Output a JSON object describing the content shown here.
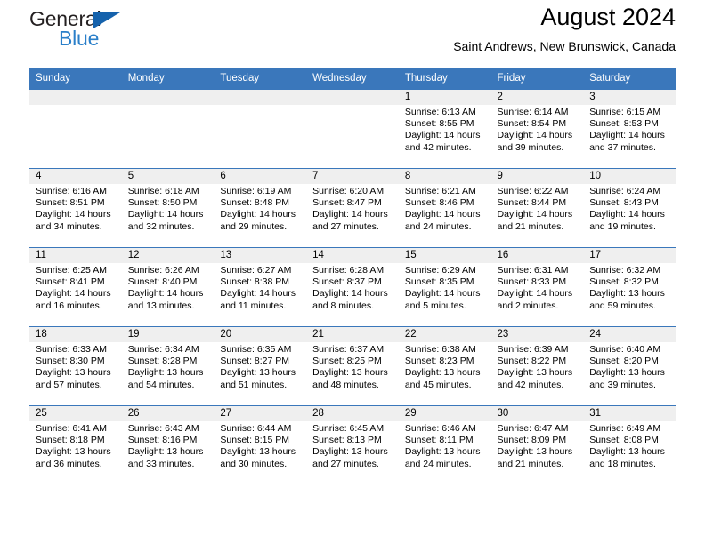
{
  "brand": {
    "name_part1": "General",
    "name_part2": "Blue",
    "triangle_color": "#1562ac",
    "blue_color": "#2a7fc9",
    "dark_color": "#231f20"
  },
  "header": {
    "title": "August 2024",
    "location": "Saint Andrews, New Brunswick, Canada",
    "accent_color": "#3a77bb",
    "band_color": "#efefef"
  },
  "weekday_headers": [
    "Sunday",
    "Monday",
    "Tuesday",
    "Wednesday",
    "Thursday",
    "Friday",
    "Saturday"
  ],
  "weeks": [
    [
      {
        "day": "",
        "sunrise": "",
        "sunset": "",
        "daylight_line1": "",
        "daylight_line2": "",
        "empty": true
      },
      {
        "day": "",
        "sunrise": "",
        "sunset": "",
        "daylight_line1": "",
        "daylight_line2": "",
        "empty": true
      },
      {
        "day": "",
        "sunrise": "",
        "sunset": "",
        "daylight_line1": "",
        "daylight_line2": "",
        "empty": true
      },
      {
        "day": "",
        "sunrise": "",
        "sunset": "",
        "daylight_line1": "",
        "daylight_line2": "",
        "empty": true
      },
      {
        "day": "1",
        "sunrise": "Sunrise: 6:13 AM",
        "sunset": "Sunset: 8:55 PM",
        "daylight_line1": "Daylight: 14 hours",
        "daylight_line2": "and 42 minutes.",
        "empty": false
      },
      {
        "day": "2",
        "sunrise": "Sunrise: 6:14 AM",
        "sunset": "Sunset: 8:54 PM",
        "daylight_line1": "Daylight: 14 hours",
        "daylight_line2": "and 39 minutes.",
        "empty": false
      },
      {
        "day": "3",
        "sunrise": "Sunrise: 6:15 AM",
        "sunset": "Sunset: 8:53 PM",
        "daylight_line1": "Daylight: 14 hours",
        "daylight_line2": "and 37 minutes.",
        "empty": false
      }
    ],
    [
      {
        "day": "4",
        "sunrise": "Sunrise: 6:16 AM",
        "sunset": "Sunset: 8:51 PM",
        "daylight_line1": "Daylight: 14 hours",
        "daylight_line2": "and 34 minutes.",
        "empty": false
      },
      {
        "day": "5",
        "sunrise": "Sunrise: 6:18 AM",
        "sunset": "Sunset: 8:50 PM",
        "daylight_line1": "Daylight: 14 hours",
        "daylight_line2": "and 32 minutes.",
        "empty": false
      },
      {
        "day": "6",
        "sunrise": "Sunrise: 6:19 AM",
        "sunset": "Sunset: 8:48 PM",
        "daylight_line1": "Daylight: 14 hours",
        "daylight_line2": "and 29 minutes.",
        "empty": false
      },
      {
        "day": "7",
        "sunrise": "Sunrise: 6:20 AM",
        "sunset": "Sunset: 8:47 PM",
        "daylight_line1": "Daylight: 14 hours",
        "daylight_line2": "and 27 minutes.",
        "empty": false
      },
      {
        "day": "8",
        "sunrise": "Sunrise: 6:21 AM",
        "sunset": "Sunset: 8:46 PM",
        "daylight_line1": "Daylight: 14 hours",
        "daylight_line2": "and 24 minutes.",
        "empty": false
      },
      {
        "day": "9",
        "sunrise": "Sunrise: 6:22 AM",
        "sunset": "Sunset: 8:44 PM",
        "daylight_line1": "Daylight: 14 hours",
        "daylight_line2": "and 21 minutes.",
        "empty": false
      },
      {
        "day": "10",
        "sunrise": "Sunrise: 6:24 AM",
        "sunset": "Sunset: 8:43 PM",
        "daylight_line1": "Daylight: 14 hours",
        "daylight_line2": "and 19 minutes.",
        "empty": false
      }
    ],
    [
      {
        "day": "11",
        "sunrise": "Sunrise: 6:25 AM",
        "sunset": "Sunset: 8:41 PM",
        "daylight_line1": "Daylight: 14 hours",
        "daylight_line2": "and 16 minutes.",
        "empty": false
      },
      {
        "day": "12",
        "sunrise": "Sunrise: 6:26 AM",
        "sunset": "Sunset: 8:40 PM",
        "daylight_line1": "Daylight: 14 hours",
        "daylight_line2": "and 13 minutes.",
        "empty": false
      },
      {
        "day": "13",
        "sunrise": "Sunrise: 6:27 AM",
        "sunset": "Sunset: 8:38 PM",
        "daylight_line1": "Daylight: 14 hours",
        "daylight_line2": "and 11 minutes.",
        "empty": false
      },
      {
        "day": "14",
        "sunrise": "Sunrise: 6:28 AM",
        "sunset": "Sunset: 8:37 PM",
        "daylight_line1": "Daylight: 14 hours",
        "daylight_line2": "and 8 minutes.",
        "empty": false
      },
      {
        "day": "15",
        "sunrise": "Sunrise: 6:29 AM",
        "sunset": "Sunset: 8:35 PM",
        "daylight_line1": "Daylight: 14 hours",
        "daylight_line2": "and 5 minutes.",
        "empty": false
      },
      {
        "day": "16",
        "sunrise": "Sunrise: 6:31 AM",
        "sunset": "Sunset: 8:33 PM",
        "daylight_line1": "Daylight: 14 hours",
        "daylight_line2": "and 2 minutes.",
        "empty": false
      },
      {
        "day": "17",
        "sunrise": "Sunrise: 6:32 AM",
        "sunset": "Sunset: 8:32 PM",
        "daylight_line1": "Daylight: 13 hours",
        "daylight_line2": "and 59 minutes.",
        "empty": false
      }
    ],
    [
      {
        "day": "18",
        "sunrise": "Sunrise: 6:33 AM",
        "sunset": "Sunset: 8:30 PM",
        "daylight_line1": "Daylight: 13 hours",
        "daylight_line2": "and 57 minutes.",
        "empty": false
      },
      {
        "day": "19",
        "sunrise": "Sunrise: 6:34 AM",
        "sunset": "Sunset: 8:28 PM",
        "daylight_line1": "Daylight: 13 hours",
        "daylight_line2": "and 54 minutes.",
        "empty": false
      },
      {
        "day": "20",
        "sunrise": "Sunrise: 6:35 AM",
        "sunset": "Sunset: 8:27 PM",
        "daylight_line1": "Daylight: 13 hours",
        "daylight_line2": "and 51 minutes.",
        "empty": false
      },
      {
        "day": "21",
        "sunrise": "Sunrise: 6:37 AM",
        "sunset": "Sunset: 8:25 PM",
        "daylight_line1": "Daylight: 13 hours",
        "daylight_line2": "and 48 minutes.",
        "empty": false
      },
      {
        "day": "22",
        "sunrise": "Sunrise: 6:38 AM",
        "sunset": "Sunset: 8:23 PM",
        "daylight_line1": "Daylight: 13 hours",
        "daylight_line2": "and 45 minutes.",
        "empty": false
      },
      {
        "day": "23",
        "sunrise": "Sunrise: 6:39 AM",
        "sunset": "Sunset: 8:22 PM",
        "daylight_line1": "Daylight: 13 hours",
        "daylight_line2": "and 42 minutes.",
        "empty": false
      },
      {
        "day": "24",
        "sunrise": "Sunrise: 6:40 AM",
        "sunset": "Sunset: 8:20 PM",
        "daylight_line1": "Daylight: 13 hours",
        "daylight_line2": "and 39 minutes.",
        "empty": false
      }
    ],
    [
      {
        "day": "25",
        "sunrise": "Sunrise: 6:41 AM",
        "sunset": "Sunset: 8:18 PM",
        "daylight_line1": "Daylight: 13 hours",
        "daylight_line2": "and 36 minutes.",
        "empty": false
      },
      {
        "day": "26",
        "sunrise": "Sunrise: 6:43 AM",
        "sunset": "Sunset: 8:16 PM",
        "daylight_line1": "Daylight: 13 hours",
        "daylight_line2": "and 33 minutes.",
        "empty": false
      },
      {
        "day": "27",
        "sunrise": "Sunrise: 6:44 AM",
        "sunset": "Sunset: 8:15 PM",
        "daylight_line1": "Daylight: 13 hours",
        "daylight_line2": "and 30 minutes.",
        "empty": false
      },
      {
        "day": "28",
        "sunrise": "Sunrise: 6:45 AM",
        "sunset": "Sunset: 8:13 PM",
        "daylight_line1": "Daylight: 13 hours",
        "daylight_line2": "and 27 minutes.",
        "empty": false
      },
      {
        "day": "29",
        "sunrise": "Sunrise: 6:46 AM",
        "sunset": "Sunset: 8:11 PM",
        "daylight_line1": "Daylight: 13 hours",
        "daylight_line2": "and 24 minutes.",
        "empty": false
      },
      {
        "day": "30",
        "sunrise": "Sunrise: 6:47 AM",
        "sunset": "Sunset: 8:09 PM",
        "daylight_line1": "Daylight: 13 hours",
        "daylight_line2": "and 21 minutes.",
        "empty": false
      },
      {
        "day": "31",
        "sunrise": "Sunrise: 6:49 AM",
        "sunset": "Sunset: 8:08 PM",
        "daylight_line1": "Daylight: 13 hours",
        "daylight_line2": "and 18 minutes.",
        "empty": false
      }
    ]
  ]
}
